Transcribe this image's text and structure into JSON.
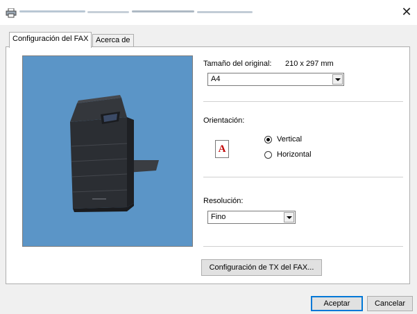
{
  "window": {
    "title": "",
    "close_glyph": "✕"
  },
  "tabs": [
    {
      "label": "Configuración del FAX",
      "active": true
    },
    {
      "label": "Acerca de",
      "active": false
    }
  ],
  "original_size": {
    "label": "Tamaño del original:",
    "dimensions": "210 x 297 mm",
    "selected": "A4"
  },
  "orientation": {
    "label": "Orientación:",
    "icon_letter": "A",
    "options": [
      {
        "label": "Vertical",
        "checked": true
      },
      {
        "label": "Horizontal",
        "checked": false
      }
    ]
  },
  "resolution": {
    "label": "Resolución:",
    "selected": "Fino"
  },
  "tx_settings_button": "Configuración de TX del FAX...",
  "footer": {
    "ok_label": "Aceptar",
    "cancel_label": "Cancelar"
  },
  "colors": {
    "preview_background": "#5b95c7",
    "orientation_letter": "#c00000",
    "default_button_border": "#0078d7"
  },
  "icons": {
    "app": "printer-icon",
    "close": "close-icon",
    "preview": "printer-device-illustration",
    "dropdown": "chevron-down-icon"
  }
}
